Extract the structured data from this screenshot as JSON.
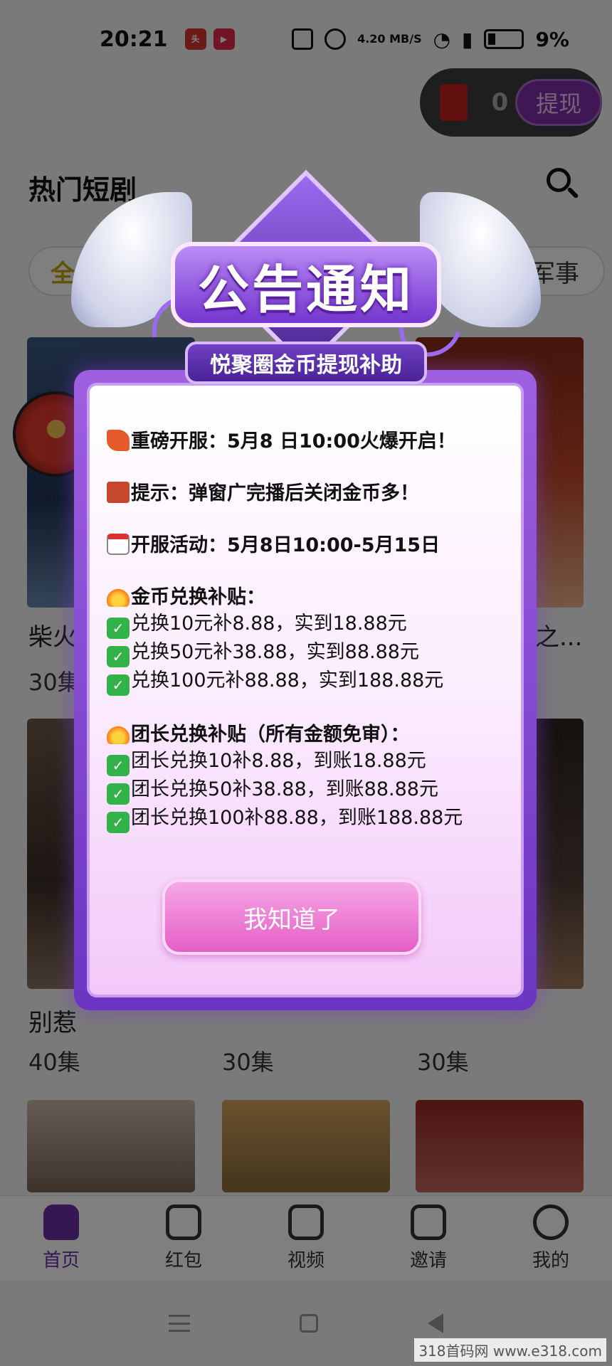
{
  "status_bar": {
    "time": "20:21",
    "net_speed": "4.20 MB/S",
    "battery": "9%"
  },
  "wallet": {
    "coins": "0",
    "withdraw_label": "提现"
  },
  "section": {
    "title": "热门短剧"
  },
  "categories": {
    "first": "全部",
    "last": "军事"
  },
  "cards": [
    {
      "title": "柴火",
      "count": "30集"
    },
    {
      "title": "之...",
      "count": ""
    },
    {
      "title": "别惹",
      "count": "40集"
    },
    {
      "title": "",
      "count": "30集"
    },
    {
      "title": "",
      "count": "30集"
    }
  ],
  "tabs": [
    {
      "label": "首页",
      "icon": "home-icon"
    },
    {
      "label": "红包",
      "icon": "red-packet-icon"
    },
    {
      "label": "视频",
      "icon": "video-icon"
    },
    {
      "label": "邀请",
      "icon": "invite-icon"
    },
    {
      "label": "我的",
      "icon": "profile-icon"
    }
  ],
  "modal": {
    "title": "公告通知",
    "subtitle": "悦聚圈金币提现补助",
    "lines": [
      {
        "icon": "rocket-icon",
        "text": "重磅开服：5月8 日10:00火爆开启！"
      },
      {
        "icon": "megaphone-icon",
        "text": "提示：弹窗广完播后关闭金币多！"
      },
      {
        "icon": "calendar-icon",
        "text": "开服活动：5月8日10:00-5月15日"
      },
      {
        "icon": "fire-icon",
        "text": "金币兑换补贴："
      },
      {
        "icon": "check-icon",
        "text": "兑换10元补8.88，实到18.88元"
      },
      {
        "icon": "check-icon",
        "text": "兑换50元补38.88，实到88.88元"
      },
      {
        "icon": "check-icon",
        "text": "兑换100元补88.88，实到188.88元"
      },
      {
        "icon": "fire-icon",
        "text": "团长兑换补贴（所有金额免审）："
      },
      {
        "icon": "check-icon",
        "text": "团长兑换10补8.88，到账18.88元"
      },
      {
        "icon": "check-icon",
        "text": "团长兑换50补38.88，到账88.88元"
      },
      {
        "icon": "check-icon",
        "text": "团长兑换100补88.88，到账188.88元"
      }
    ],
    "ok_label": "我知道了"
  },
  "watermark": "318首码网 www.e318.com",
  "colors": {
    "accent": "#6b2ea8",
    "modal_border": "#9e5fe0",
    "button": "#e45ec5"
  }
}
